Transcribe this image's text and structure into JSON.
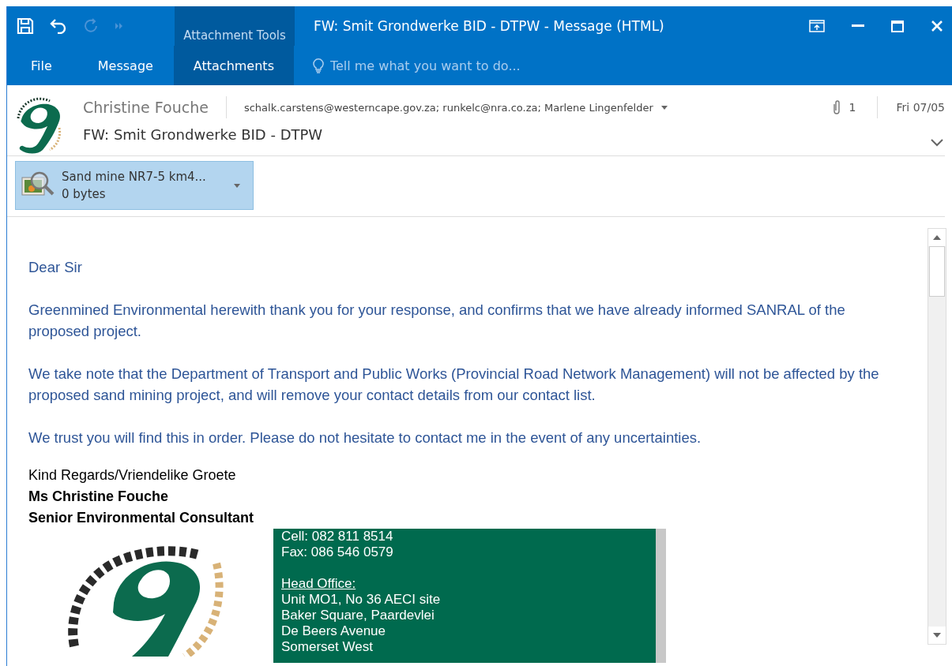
{
  "window": {
    "title": "FW: Smit Grondwerke BID - DTPW - Message (HTML)",
    "context_group": "Attachment Tools"
  },
  "quick_access": [
    {
      "kind": "save",
      "disabled": false
    },
    {
      "kind": "undo",
      "disabled": false
    },
    {
      "kind": "redo",
      "disabled": true
    },
    {
      "kind": "more",
      "disabled": true
    }
  ],
  "ribbon_tabs": [
    {
      "label": "File",
      "selected": false
    },
    {
      "label": "Message",
      "selected": false
    },
    {
      "label": "Attachments",
      "selected": true
    }
  ],
  "tell_me": {
    "placeholder": "Tell me what you want to do..."
  },
  "header": {
    "sender": "Christine Fouche",
    "recipients": "schalk.carstens@westerncape.gov.za; runkelc@nra.co.za; Marlene Lingenfelder",
    "attachment_count": "1",
    "date": "Fri 07/05",
    "subject": "FW: Smit Grondwerke BID - DTPW"
  },
  "attachments": [
    {
      "name": "Sand mine NR7-5 km4...",
      "size": "0 bytes",
      "selected": true
    }
  ],
  "body": {
    "paragraphs": [
      "Dear Sir",
      "Greenmined Environmental herewith thank you for your response, and confirms that we have already informed SANRAL of the proposed project.",
      "We take note that the Department of Transport and Public Works (Provincial Road Network Management) will not be affected by the proposed sand mining project, and will remove your contact details from our contact list.",
      "We trust you will find this in order.  Please do not hesitate to contact me in the event of any uncertainties."
    ],
    "closing": "Kind Regards/Vriendelike Groete",
    "signature_name": "Ms Christine Fouche",
    "signature_title": "Senior Environmental Consultant",
    "contact": {
      "lines": [
        "Cell: 082 811 8514",
        "Fax: 086 546 0579"
      ],
      "office_heading": "Head Office:",
      "address": [
        "Unit MO1, No 36 AECI site",
        "Baker Square, Paardevlei",
        "De Beers Avenue",
        "Somerset West"
      ]
    }
  }
}
